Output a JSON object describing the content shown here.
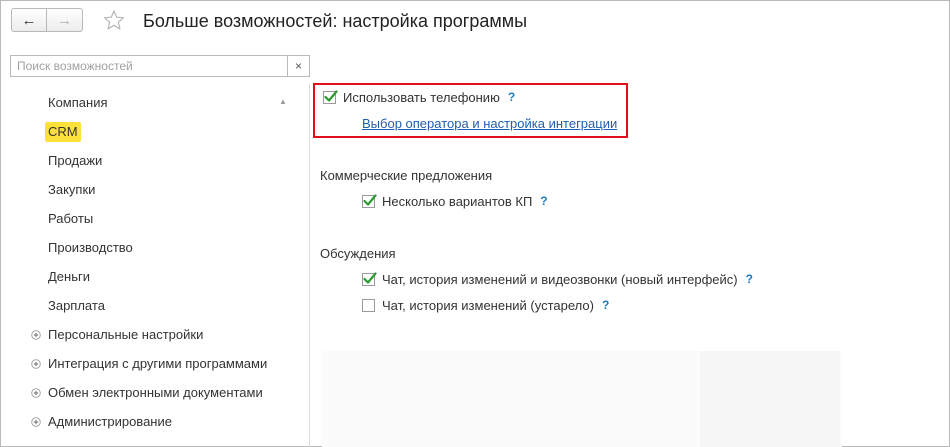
{
  "header": {
    "back_label": "←",
    "forward_label": "→",
    "title": "Больше возможностей: настройка программы"
  },
  "sidebar": {
    "search_placeholder": "Поиск возможностей",
    "search_clear": "×",
    "items": [
      {
        "label": "Компания",
        "expandable": false,
        "active": false
      },
      {
        "label": "CRM",
        "expandable": false,
        "active": true
      },
      {
        "label": "Продажи",
        "expandable": false,
        "active": false
      },
      {
        "label": "Закупки",
        "expandable": false,
        "active": false
      },
      {
        "label": "Работы",
        "expandable": false,
        "active": false
      },
      {
        "label": "Производство",
        "expandable": false,
        "active": false
      },
      {
        "label": "Деньги",
        "expandable": false,
        "active": false
      },
      {
        "label": "Зарплата",
        "expandable": false,
        "active": false
      },
      {
        "label": "Персональные настройки",
        "expandable": true,
        "active": false
      },
      {
        "label": "Интеграция с другими программами",
        "expandable": true,
        "active": false
      },
      {
        "label": "Обмен электронными документами",
        "expandable": true,
        "active": false
      },
      {
        "label": "Администрирование",
        "expandable": true,
        "active": false
      }
    ]
  },
  "main": {
    "telephony": {
      "checkbox_label": "Использовать телефонию",
      "checked": true,
      "help": "?",
      "link": "Выбор оператора и настройка интеграции"
    },
    "commercial": {
      "title": "Коммерческие предложения",
      "checkbox_label": "Несколько вариантов КП",
      "checked": true,
      "help": "?"
    },
    "discussions": {
      "title": "Обсуждения",
      "new_label": "Чат, история изменений и видеозвонки (новый интерфейс)",
      "new_checked": true,
      "old_label": "Чат, история изменений (устарело)",
      "old_checked": false,
      "help": "?"
    }
  },
  "colors": {
    "active_highlight": "#fde13a",
    "check_mark": "#2b9a2b",
    "help": "#1c7cc2",
    "link": "#1f5fb1",
    "highlight_box": "#e0101d"
  }
}
